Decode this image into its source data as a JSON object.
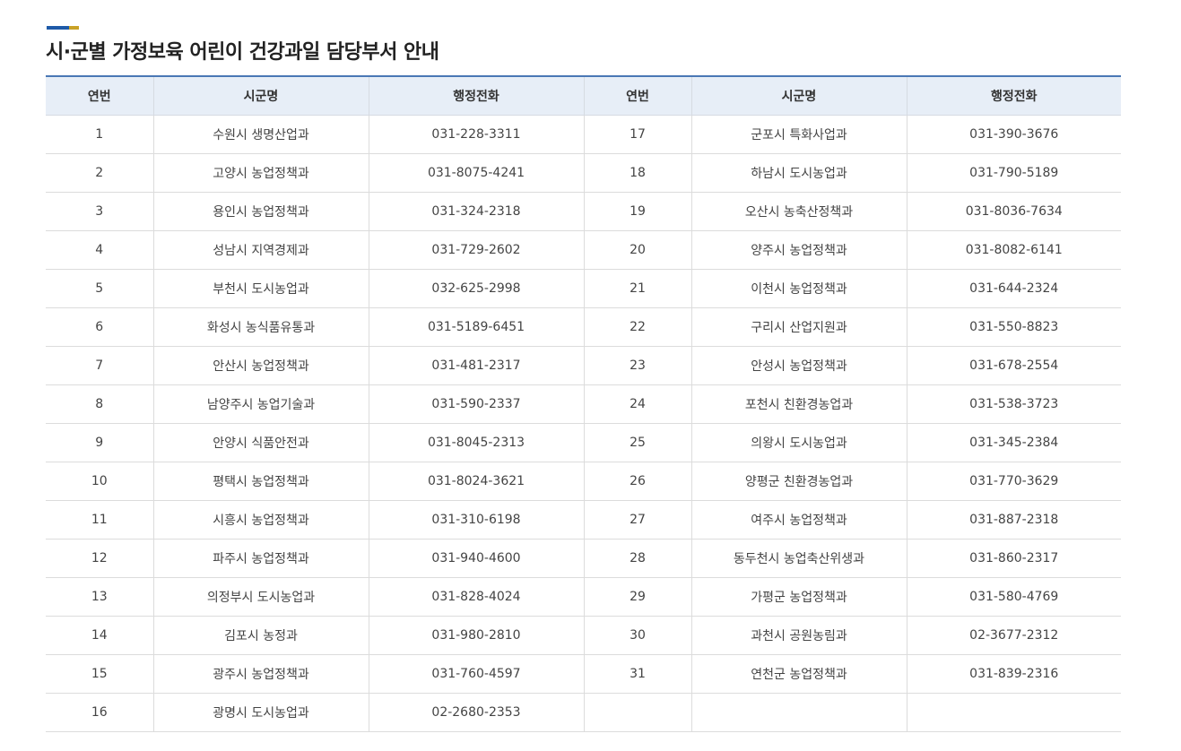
{
  "title": "시·군별 가정보육 어린이 건강과일 담당부서 안내",
  "colors": {
    "accent_blue": "#1e5aa8",
    "accent_gold": "#c9a227",
    "header_bg": "#e7eef7",
    "header_border": "#4a78b5"
  },
  "table": {
    "headers": [
      "연번",
      "시군명",
      "행정전화",
      "연번",
      "시군명",
      "행정전화"
    ],
    "rows": [
      [
        "1",
        "수원시 생명산업과",
        "031-228-3311",
        "17",
        "군포시 특화사업과",
        "031-390-3676"
      ],
      [
        "2",
        "고양시 농업정책과",
        "031-8075-4241",
        "18",
        "하남시 도시농업과",
        "031-790-5189"
      ],
      [
        "3",
        "용인시 농업정책과",
        "031-324-2318",
        "19",
        "오산시 농축산정책과",
        "031-8036-7634"
      ],
      [
        "4",
        "성남시 지역경제과",
        "031-729-2602",
        "20",
        "양주시 농업정책과",
        "031-8082-6141"
      ],
      [
        "5",
        "부천시 도시농업과",
        "032-625-2998",
        "21",
        "이천시 농업정책과",
        "031-644-2324"
      ],
      [
        "6",
        "화성시 농식품유통과",
        "031-5189-6451",
        "22",
        "구리시 산업지원과",
        "031-550-8823"
      ],
      [
        "7",
        "안산시 농업정책과",
        "031-481-2317",
        "23",
        "안성시 농업정책과",
        "031-678-2554"
      ],
      [
        "8",
        "남양주시 농업기술과",
        "031-590-2337",
        "24",
        "포천시 친환경농업과",
        "031-538-3723"
      ],
      [
        "9",
        "안양시 식품안전과",
        "031-8045-2313",
        "25",
        "의왕시 도시농업과",
        "031-345-2384"
      ],
      [
        "10",
        "평택시 농업정책과",
        "031-8024-3621",
        "26",
        "양평군 친환경농업과",
        "031-770-3629"
      ],
      [
        "11",
        "시흥시 농업정책과",
        "031-310-6198",
        "27",
        "여주시 농업정책과",
        "031-887-2318"
      ],
      [
        "12",
        "파주시 농업정책과",
        "031-940-4600",
        "28",
        "동두천시 농업축산위생과",
        "031-860-2317"
      ],
      [
        "13",
        "의정부시 도시농업과",
        "031-828-4024",
        "29",
        "가평군 농업정책과",
        "031-580-4769"
      ],
      [
        "14",
        "김포시 농정과",
        "031-980-2810",
        "30",
        "과천시 공원농림과",
        "02-3677-2312"
      ],
      [
        "15",
        "광주시 농업정책과",
        "031-760-4597",
        "31",
        "연천군 농업정책과",
        "031-839-2316"
      ],
      [
        "16",
        "광명시 도시농업과",
        "02-2680-2353",
        "",
        "",
        ""
      ]
    ]
  }
}
